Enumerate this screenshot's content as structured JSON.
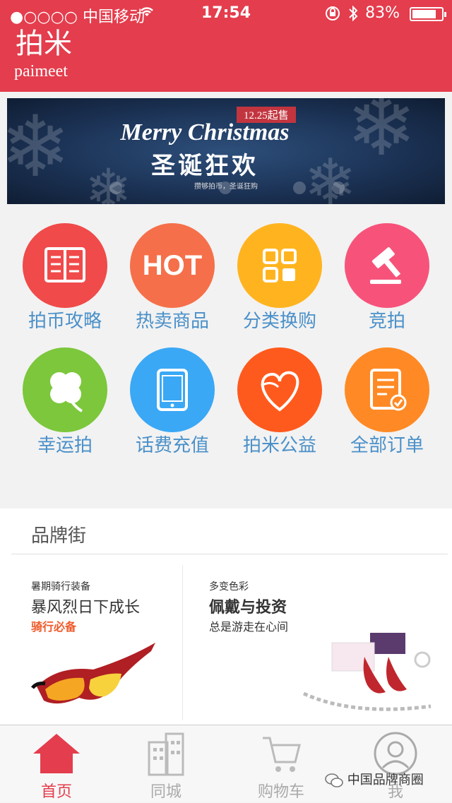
{
  "status_bar": {
    "carrier": "●○○○○ 中国移动",
    "time": "17:54",
    "battery": "83%",
    "battery_level": 0.83
  },
  "header": {
    "title": "拍米",
    "subtitle": "paimeet",
    "color": "#e43d4d"
  },
  "banner": {
    "date_tag": "12.25起售",
    "title_en": "Merry Christmas",
    "title_cn": "圣诞狂欢",
    "tagline": "攒够拍币，圣诞狂购"
  },
  "grid": {
    "items": [
      {
        "label": "拍币攻略",
        "icon": "book-icon",
        "color": "#f04a4a"
      },
      {
        "label": "热卖商品",
        "icon": "hot-icon",
        "color": "#f5704a"
      },
      {
        "label": "分类换购",
        "icon": "category-grid-icon",
        "color": "#ffb41f"
      },
      {
        "label": "竞拍",
        "icon": "gavel-icon",
        "color": "#f7537a"
      },
      {
        "label": "幸运拍",
        "icon": "clover-icon",
        "color": "#7cc73b"
      },
      {
        "label": "话费充值",
        "icon": "phone-icon",
        "color": "#3aa8f5"
      },
      {
        "label": "拍米公益",
        "icon": "heart-icon",
        "color": "#ff5a1d"
      },
      {
        "label": "全部订单",
        "icon": "order-icon",
        "color": "#ff8a25"
      }
    ],
    "hot_text": "HOT"
  },
  "brand_street": {
    "title": "品牌街",
    "left": {
      "small": "暑期骑行装备",
      "big": "暴风烈日下成长",
      "red": "骑行必备"
    },
    "right": {
      "small": "多变色彩",
      "big": "佩戴与投资",
      "sub": "总是游走在心间"
    }
  },
  "tabbar": {
    "tabs": [
      {
        "label": "首页",
        "icon": "home-icon"
      },
      {
        "label": "同城",
        "icon": "building-icon"
      },
      {
        "label": "购物车",
        "icon": "cart-icon"
      },
      {
        "label": "我",
        "icon": "user-icon"
      }
    ],
    "active": "首页"
  },
  "watermark": "中国品牌商圈"
}
